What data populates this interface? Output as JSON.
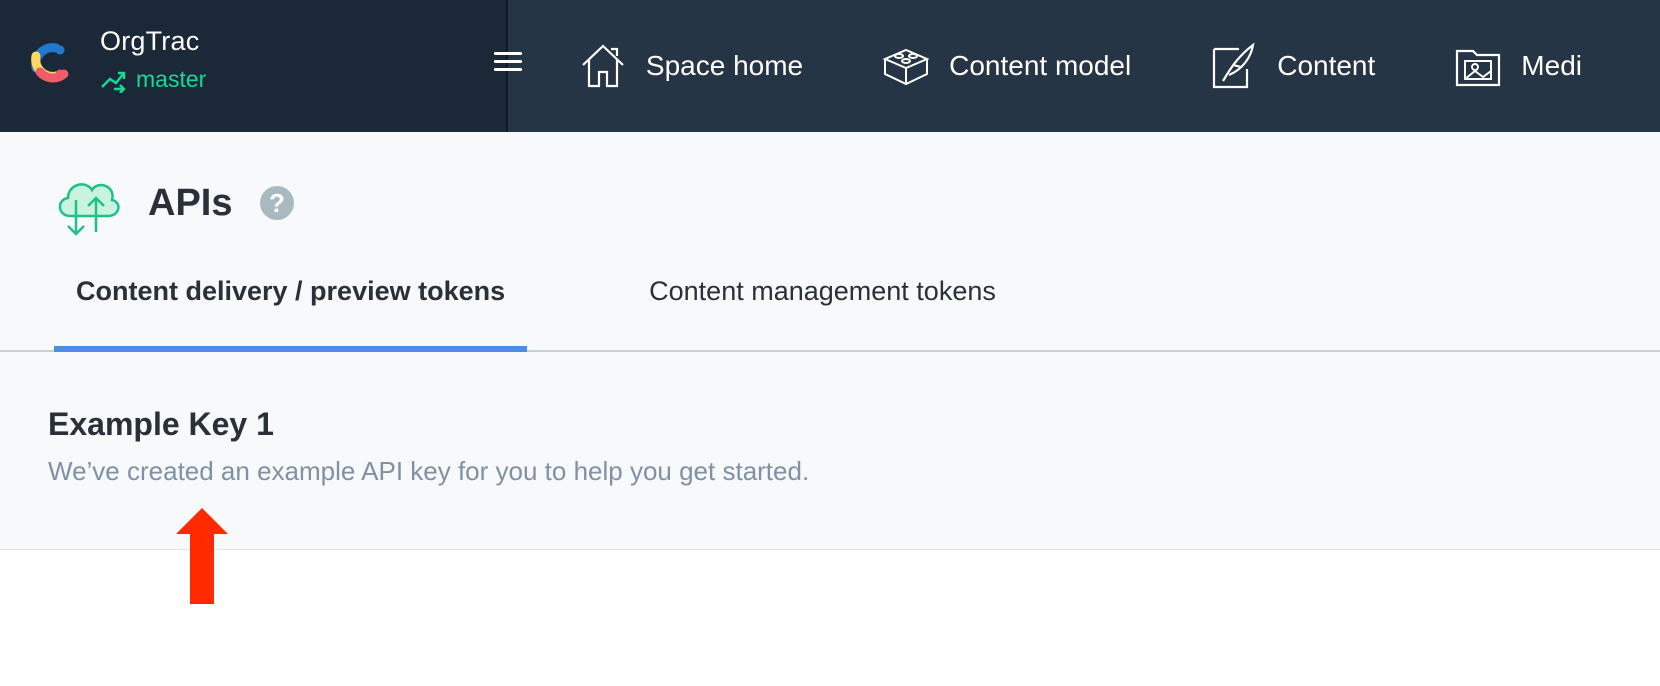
{
  "space": {
    "name": "OrgTrac",
    "environment": "master"
  },
  "nav": {
    "items": [
      {
        "label": "Space home",
        "icon": "house-icon"
      },
      {
        "label": "Content model",
        "icon": "blocks-icon"
      },
      {
        "label": "Content",
        "icon": "quill-document-icon"
      },
      {
        "label": "Medi",
        "icon": "media-icon"
      }
    ]
  },
  "page": {
    "title": "APIs",
    "help_glyph": "?",
    "tabs": [
      {
        "label": "Content delivery / preview tokens",
        "active": true
      },
      {
        "label": "Content management tokens",
        "active": false
      }
    ]
  },
  "key": {
    "title": "Example Key 1",
    "description": "We’ve created an example API key for you to help you get started."
  },
  "colors": {
    "topbar": "#263545",
    "space_switch": "#1b2837",
    "env_green": "#14d997",
    "tab_underline": "#4a90e2",
    "arrow_red": "#ff2a00",
    "api_icon_green": "#1fc08a"
  }
}
